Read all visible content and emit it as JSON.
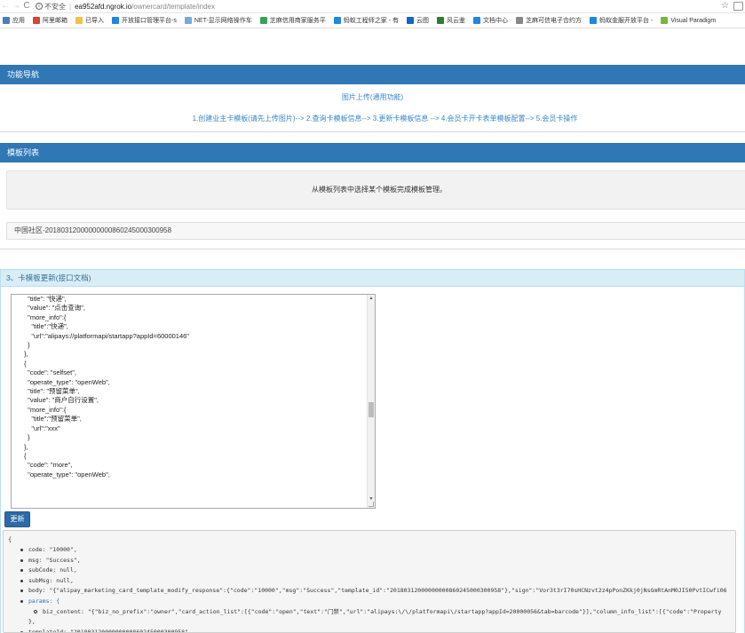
{
  "browser": {
    "back": "←",
    "forward": "→",
    "reload": "C",
    "insecure_label": "不安全",
    "url_host": "ea952afd.ngrok.io",
    "url_path": "/ownercard/template/index",
    "bookmarks": [
      {
        "label": "应用",
        "icon": "apps-grid-icon",
        "color": "#4a7ebb"
      },
      {
        "label": "阿里邮箱",
        "icon": "mail-icon",
        "color": "#d44638"
      },
      {
        "label": "已导入",
        "icon": "folder-icon",
        "color": "#f0c348"
      },
      {
        "label": "开放接口管理平台-s",
        "icon": "alipay-icon",
        "color": "#1e88e5"
      },
      {
        "label": "NET-显示网络操作车",
        "icon": "globe-icon",
        "color": "#7aa7d9"
      },
      {
        "label": "芝麻信用商家服务平",
        "icon": "sesame-icon",
        "color": "#3aa15a"
      },
      {
        "label": "蚂蚁工程师之家 - 有",
        "icon": "ant-icon",
        "color": "#1e88e5"
      },
      {
        "label": "云图",
        "icon": "cloud-icon",
        "color": "#1565c0"
      },
      {
        "label": "风云鉴",
        "icon": "wind-icon",
        "color": "#2e7d32"
      },
      {
        "label": "文档中心",
        "icon": "doc-icon",
        "color": "#1e88e5"
      },
      {
        "label": "芝麻可信电子合约方",
        "icon": "contract-icon",
        "color": "#888888"
      },
      {
        "label": "蚂蚁金服开放平台 -",
        "icon": "antfin-icon",
        "color": "#1e88e5"
      },
      {
        "label": "Visual Paradigm",
        "icon": "code-icon",
        "color": "#7cb342"
      }
    ]
  },
  "nav": {
    "title": "功能导航",
    "upload_link": "图片上传(通用功能)",
    "steps": [
      {
        "label": "1.创建业主卡模板(请先上传图片)"
      },
      {
        "label": "2.查询卡模板信息"
      },
      {
        "label": "3.更新卡模板信息"
      },
      {
        "label": "4.会员卡开卡表单模板配置"
      },
      {
        "label": "5.会员卡操作"
      }
    ],
    "step_seps": [
      "--> ",
      "--> ",
      " --> ",
      "--> "
    ]
  },
  "template_list": {
    "title": "模板列表",
    "notice": "从模板列表中选择某个模板完成模板管理。",
    "item": "中国社区-20180312000000000860245000300958"
  },
  "update_panel": {
    "heading_prefix": "3、卡模板更新(",
    "heading_link": "接口文档",
    "heading_suffix": ")",
    "editor_lines": [
      "  \"title\": \"快递\",",
      "  \"value\": \"点击查询\",",
      "  \"more_info\":{",
      "    \"title\":\"快递\",",
      "    \"url\":\"alipays://platformapi/startapp?appId=60000146\"",
      "  }",
      "},",
      "{",
      "  \"code\": \"selfset\",",
      "  \"operate_type\": \"openWeb\",",
      "  \"title\": \"预留菜单\",",
      "  \"value\": \"商户自行设置\",",
      "  \"more_info\":{",
      "    \"title\":\"预留菜单\",",
      "    \"url\":\"xxx\"",
      "  }",
      "},",
      "{",
      "  \"code\": \"more\",",
      "  \"operate_type\": \"openWeb\","
    ],
    "update_button": "更新"
  },
  "result": {
    "open_brace": "{",
    "lines": [
      {
        "kind": "item",
        "text": "code: \"10000\","
      },
      {
        "kind": "item",
        "text": "msg: \"Success\","
      },
      {
        "kind": "item",
        "text": "subCode: null,"
      },
      {
        "kind": "item",
        "text": "subMsg: null,"
      },
      {
        "kind": "item",
        "text": "body: \"{\"alipay_marketing_card_template_modify_response\":{\"code\":\"10000\",\"msg\":\"Success\",\"template_id\":\"20180312000000000860245000300958\"},\"sign\":\"Vor3t3rI70sHCNzvt2z4pPonZKkj0jNsGmRtAnM0JI50PvtICwfi06"
      },
      {
        "kind": "item",
        "text": "params: {"
      },
      {
        "kind": "sub",
        "text": "biz_content: \"{\"biz_no_prefix\":\"owner\",\"card_action_list\":[{\"code\":\"open\",\"text\":\"门禁\",\"url\":\"alipays:\\/\\/platformapi\\/startapp?appId=20000056&tab=barcode\"}],\"column_info_list\":[{\"code\":\"Property"
      },
      {
        "kind": "close",
        "text": "},"
      },
      {
        "kind": "item",
        "text": "templateId: \"20180312000000000860245000300958\","
      }
    ]
  },
  "colors": {
    "nav_bar": "#2f77b5",
    "link": "#3a86c8",
    "panel_head_bg": "#d9edf7",
    "panel_head_text": "#31708f",
    "button": "#2b6aa6"
  }
}
